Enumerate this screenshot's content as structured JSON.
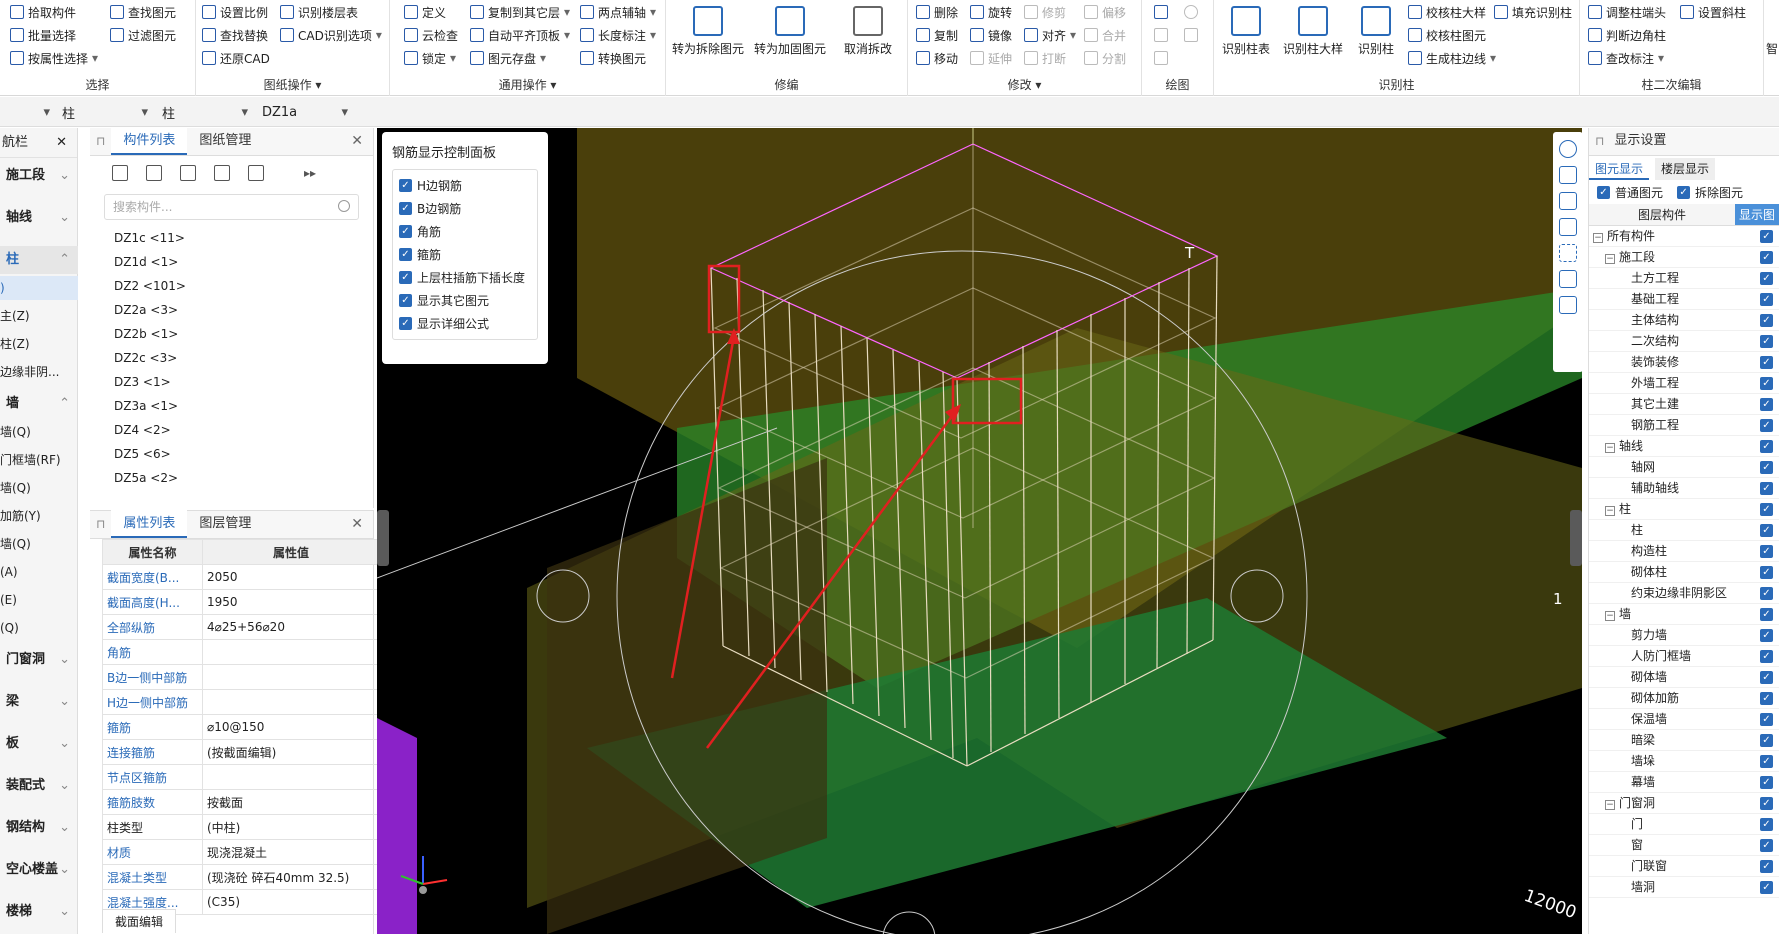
{
  "ribbon": {
    "groups": [
      {
        "title": "选择",
        "buttons": [
          "拾取构件",
          "批量选择",
          "按属性选择",
          "查找图元",
          "过滤图元"
        ]
      },
      {
        "title": "图纸操作",
        "buttons": [
          "设置比例",
          "识别楼层表",
          "查找替换",
          "CAD识别选项",
          "还原CAD"
        ]
      },
      {
        "title": "通用操作",
        "buttons": [
          "定义",
          "复制到其它层",
          "两点辅轴",
          "云检查",
          "自动平齐顶板",
          "长度标注",
          "锁定",
          "图元存盘",
          "转换图元"
        ]
      },
      {
        "title": "修编",
        "buttons": [
          "转为拆除图元",
          "转为加固图元",
          "取消拆改"
        ]
      },
      {
        "title": "修改",
        "buttons": [
          "删除",
          "旋转",
          "修剪",
          "偏移",
          "复制",
          "镜像",
          "对齐",
          "合并",
          "移动",
          "延伸",
          "打断",
          "分割"
        ]
      },
      {
        "title": "绘图",
        "buttons": []
      },
      {
        "title": "识别柱",
        "buttons": [
          "识别柱表",
          "识别柱大样",
          "识别柱",
          "校核柱大样",
          "填充识别柱",
          "校核柱图元",
          "生成柱边线"
        ]
      },
      {
        "title": "柱二次编辑",
        "buttons": [
          "调整柱端头",
          "设置斜柱",
          "判断边角柱",
          "查改标注"
        ]
      }
    ],
    "overflow": "智"
  },
  "selectors": [
    "柱",
    "柱",
    "DZ1a"
  ],
  "nav": {
    "header": "航栏",
    "items": [
      "施工段",
      "轴线",
      "柱",
      "墙",
      "门窗洞",
      "梁",
      "板",
      "装配式",
      "钢结构",
      "空心楼盖",
      "楼梯"
    ],
    "sub_column": [
      ")",
      "主(Z)",
      "柱(Z)",
      "边缘非阴..."
    ],
    "sub_wall": [
      "墙(Q)",
      "门框墙(RF)",
      "墙(Q)",
      "加筋(Y)",
      "墙(Q)",
      "(A)",
      "(E)",
      "(Q)"
    ]
  },
  "component_panel": {
    "tabs": [
      "构件列表",
      "图纸管理"
    ],
    "search_placeholder": "搜索构件...",
    "items": [
      "DZ1c <11>",
      "DZ1d <1>",
      "DZ2 <101>",
      "DZ2a <3>",
      "DZ2b <1>",
      "DZ2c <3>",
      "DZ3 <1>",
      "DZ3a <1>",
      "DZ4 <2>",
      "DZ5 <6>",
      "DZ5a <2>"
    ]
  },
  "property_panel": {
    "tabs": [
      "属性列表",
      "图层管理"
    ],
    "header_name": "属性名称",
    "header_value": "属性值",
    "rows": [
      {
        "name": "截面宽度(B...",
        "value": "2050",
        "blue": true
      },
      {
        "name": "截面高度(H...",
        "value": "1950",
        "blue": true
      },
      {
        "name": "全部纵筋",
        "value": "4⌀25+56⌀20",
        "blue": true
      },
      {
        "name": "角筋",
        "value": "",
        "blue": true
      },
      {
        "name": "B边一侧中部筋",
        "value": "",
        "blue": true
      },
      {
        "name": "H边一侧中部筋",
        "value": "",
        "blue": true
      },
      {
        "name": "箍筋",
        "value": "⌀10@150",
        "blue": true
      },
      {
        "name": "连接箍筋",
        "value": "(按截面编辑)",
        "blue": true
      },
      {
        "name": "节点区箍筋",
        "value": "",
        "blue": true
      },
      {
        "name": "箍筋肢数",
        "value": "按截面",
        "blue": true
      },
      {
        "name": "柱类型",
        "value": "(中柱)",
        "blue": false
      },
      {
        "name": "材质",
        "value": "现浇混凝土",
        "blue": true
      },
      {
        "name": "混凝土类型",
        "value": "(现浇砼 碎石40mm 32.5)",
        "blue": true
      },
      {
        "name": "混凝土强度...",
        "value": "(C35)",
        "blue": true
      }
    ],
    "bottom_button": "截面编辑"
  },
  "rebar_panel": {
    "title": "钢筋显示控制面板",
    "options": [
      "H边钢筋",
      "B边钢筋",
      "角筋",
      "箍筋",
      "上层柱插筋下插长度",
      "显示其它图元",
      "显示详细公式"
    ]
  },
  "viewport": {
    "labels": [
      "1",
      "T",
      "T",
      "1",
      "12000"
    ]
  },
  "display_panel": {
    "title": "显示设置",
    "tabs": [
      "图元显示",
      "楼层显示"
    ],
    "options": [
      "普通图元",
      "拆除图元"
    ],
    "col_component": "图层构件",
    "col_show": "显示图",
    "tree": [
      {
        "label": "所有构件",
        "level": 0,
        "tog": "−"
      },
      {
        "label": "施工段",
        "level": 1,
        "tog": "−"
      },
      {
        "label": "土方工程",
        "level": 2
      },
      {
        "label": "基础工程",
        "level": 2
      },
      {
        "label": "主体结构",
        "level": 2
      },
      {
        "label": "二次结构",
        "level": 2
      },
      {
        "label": "装饰装修",
        "level": 2
      },
      {
        "label": "外墙工程",
        "level": 2
      },
      {
        "label": "其它土建",
        "level": 2
      },
      {
        "label": "钢筋工程",
        "level": 2
      },
      {
        "label": "轴线",
        "level": 1,
        "tog": "−"
      },
      {
        "label": "轴网",
        "level": 2
      },
      {
        "label": "辅助轴线",
        "level": 2
      },
      {
        "label": "柱",
        "level": 1,
        "tog": "−"
      },
      {
        "label": "柱",
        "level": 2
      },
      {
        "label": "构造柱",
        "level": 2
      },
      {
        "label": "砌体柱",
        "level": 2
      },
      {
        "label": "约束边缘非阴影区",
        "level": 2
      },
      {
        "label": "墙",
        "level": 1,
        "tog": "−"
      },
      {
        "label": "剪力墙",
        "level": 2
      },
      {
        "label": "人防门框墙",
        "level": 2
      },
      {
        "label": "砌体墙",
        "level": 2
      },
      {
        "label": "砌体加筋",
        "level": 2
      },
      {
        "label": "保温墙",
        "level": 2
      },
      {
        "label": "暗梁",
        "level": 2
      },
      {
        "label": "墙垛",
        "level": 2
      },
      {
        "label": "幕墙",
        "level": 2
      },
      {
        "label": "门窗洞",
        "level": 1,
        "tog": "−"
      },
      {
        "label": "门",
        "level": 2
      },
      {
        "label": "窗",
        "level": 2
      },
      {
        "label": "门联窗",
        "level": 2
      },
      {
        "label": "墙洞",
        "level": 2
      }
    ]
  }
}
